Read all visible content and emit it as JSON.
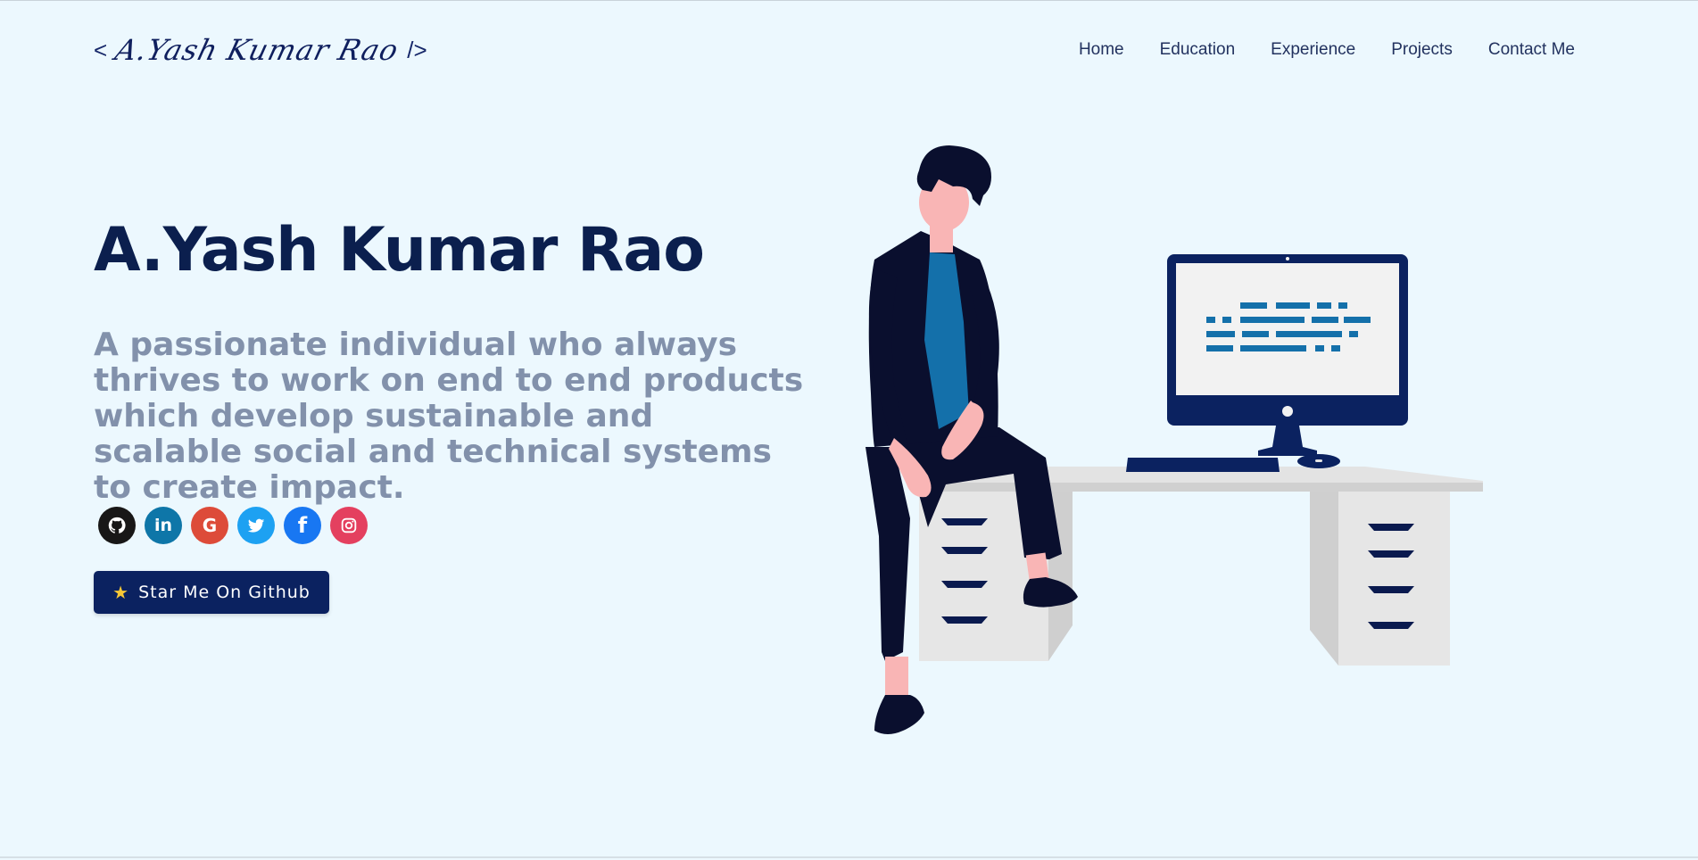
{
  "header": {
    "logo_left": "<",
    "logo_name": "A.Yash Kumar Rao",
    "logo_right": "/>",
    "nav": [
      {
        "label": "Home"
      },
      {
        "label": "Education"
      },
      {
        "label": "Experience"
      },
      {
        "label": "Projects"
      },
      {
        "label": "Contact Me"
      }
    ]
  },
  "hero": {
    "title": "A.Yash Kumar Rao",
    "subtitle": "A passionate individual who always thrives to work on end to end products which develop sustainable and scalable social and technical systems to create impact."
  },
  "social": [
    {
      "name": "github",
      "color": "#181717"
    },
    {
      "name": "linkedin",
      "color": "#0e76a8",
      "glyph": "in"
    },
    {
      "name": "google",
      "color": "#dd4b39",
      "glyph": "G"
    },
    {
      "name": "twitter",
      "color": "#1da1f2"
    },
    {
      "name": "facebook",
      "color": "#1877f2",
      "glyph": "f"
    },
    {
      "name": "instagram",
      "color": "#e4405f"
    }
  ],
  "button": {
    "label": "Star Me On Github",
    "star_color": "#f7c836",
    "bg_color": "#0b2260"
  },
  "colors": {
    "background": "#ecf8fe",
    "title": "#0b1f4e",
    "subtitle": "#8291ab",
    "navy": "#0a1a3f",
    "shirt": "#1470aa",
    "skin": "#f9b5b5",
    "desk": "#e3e3e3"
  }
}
